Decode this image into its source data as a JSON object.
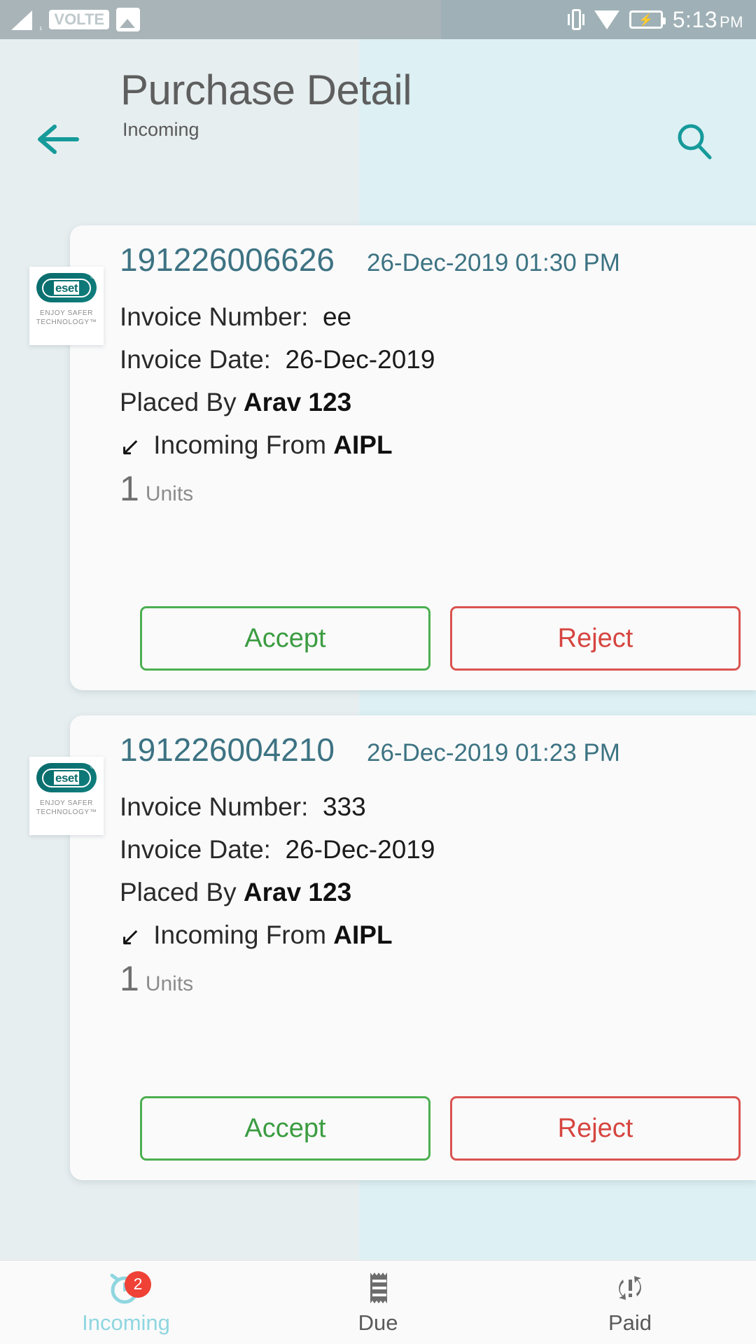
{
  "statusbar": {
    "volte_label": "VOLTE",
    "time": "5:13",
    "ampm": "PM",
    "icons": [
      "signal-icon",
      "volte-icon",
      "image-icon",
      "vibrate-icon",
      "wifi-icon",
      "battery-charging-icon"
    ]
  },
  "header": {
    "title": "Purchase Detail",
    "subtitle": "Incoming",
    "back_icon": "back-arrow-icon",
    "search_icon": "search-icon"
  },
  "colors": {
    "accent_teal": "#1a9a9a",
    "order_text": "#3d7383",
    "accept_green": "#4caf50",
    "reject_red": "#d9534f",
    "badge_red": "#ef4136",
    "active_nav": "#8fd6e0"
  },
  "logo": {
    "brand": "eset",
    "tagline_line1": "ENJOY SAFER",
    "tagline_line2": "TECHNOLOGY™"
  },
  "labels": {
    "invoice_number": "Invoice Number:",
    "invoice_date": "Invoice Date:",
    "placed_by": "Placed By",
    "incoming_from": "Incoming From",
    "units": "Units",
    "accept": "Accept",
    "reject": "Reject"
  },
  "cards": [
    {
      "order_number": "191226006626",
      "datetime": "26-Dec-2019 01:30 PM",
      "invoice_number": "ee",
      "invoice_date": "26-Dec-2019",
      "placed_by": "Arav 123",
      "incoming_from": "AIPL",
      "quantity": "1"
    },
    {
      "order_number": "191226004210",
      "datetime": "26-Dec-2019 01:23 PM",
      "invoice_number": "333",
      "invoice_date": "26-Dec-2019",
      "placed_by": "Arav 123",
      "incoming_from": "AIPL",
      "quantity": "1"
    }
  ],
  "bottomnav": {
    "items": [
      {
        "label": "Incoming",
        "icon": "alarm-clock-icon",
        "badge": "2",
        "active": true
      },
      {
        "label": "Due",
        "icon": "receipt-icon",
        "badge": "",
        "active": false
      },
      {
        "label": "Paid",
        "icon": "refresh-alert-icon",
        "badge": "",
        "active": false
      }
    ]
  }
}
